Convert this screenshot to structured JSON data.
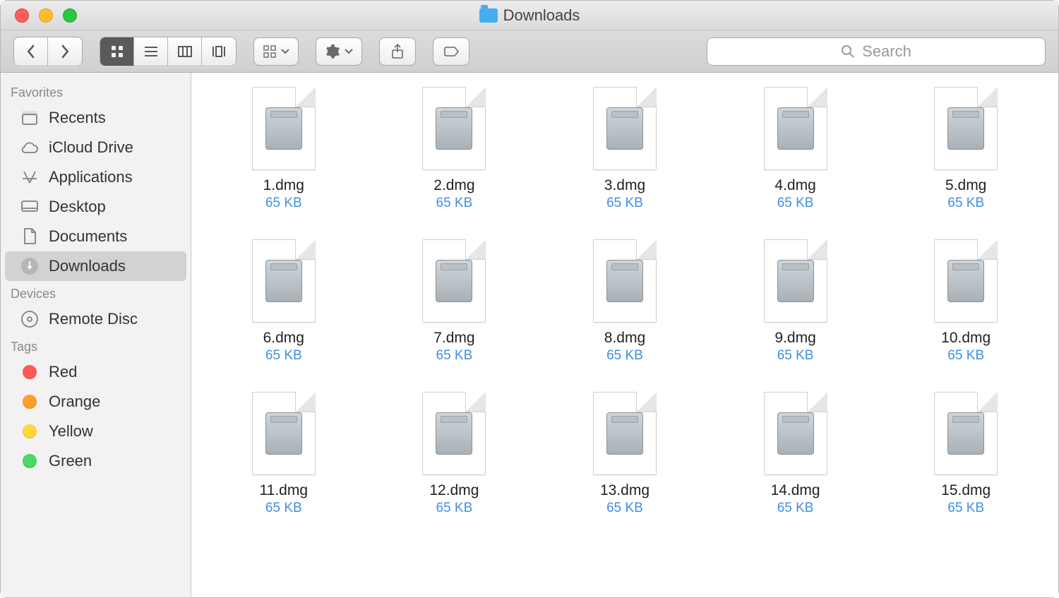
{
  "window": {
    "title": "Downloads"
  },
  "search": {
    "placeholder": "Search"
  },
  "sidebar": {
    "sections": [
      {
        "header": "Favorites",
        "items": [
          {
            "id": "recents",
            "label": "Recents",
            "icon": "clock",
            "active": false
          },
          {
            "id": "icloud",
            "label": "iCloud Drive",
            "icon": "cloud",
            "active": false
          },
          {
            "id": "applications",
            "label": "Applications",
            "icon": "apps",
            "active": false
          },
          {
            "id": "desktop",
            "label": "Desktop",
            "icon": "desktop",
            "active": false
          },
          {
            "id": "documents",
            "label": "Documents",
            "icon": "doc",
            "active": false
          },
          {
            "id": "downloads",
            "label": "Downloads",
            "icon": "download",
            "active": true
          }
        ]
      },
      {
        "header": "Devices",
        "items": [
          {
            "id": "remote-disc",
            "label": "Remote Disc",
            "icon": "disc",
            "active": false
          }
        ]
      },
      {
        "header": "Tags",
        "items": [
          {
            "id": "red",
            "label": "Red",
            "color": "#ff5b59"
          },
          {
            "id": "orange",
            "label": "Orange",
            "color": "#ff9f29"
          },
          {
            "id": "yellow",
            "label": "Yellow",
            "color": "#ffd93a"
          },
          {
            "id": "green",
            "label": "Green",
            "color": "#4cd863"
          }
        ]
      }
    ]
  },
  "files": [
    {
      "name": "1.dmg",
      "size": "65 KB"
    },
    {
      "name": "2.dmg",
      "size": "65 KB"
    },
    {
      "name": "3.dmg",
      "size": "65 KB"
    },
    {
      "name": "4.dmg",
      "size": "65 KB"
    },
    {
      "name": "5.dmg",
      "size": "65 KB"
    },
    {
      "name": "6.dmg",
      "size": "65 KB"
    },
    {
      "name": "7.dmg",
      "size": "65 KB"
    },
    {
      "name": "8.dmg",
      "size": "65 KB"
    },
    {
      "name": "9.dmg",
      "size": "65 KB"
    },
    {
      "name": "10.dmg",
      "size": "65 KB"
    },
    {
      "name": "11.dmg",
      "size": "65 KB"
    },
    {
      "name": "12.dmg",
      "size": "65 KB"
    },
    {
      "name": "13.dmg",
      "size": "65 KB"
    },
    {
      "name": "14.dmg",
      "size": "65 KB"
    },
    {
      "name": "15.dmg",
      "size": "65 KB"
    }
  ]
}
